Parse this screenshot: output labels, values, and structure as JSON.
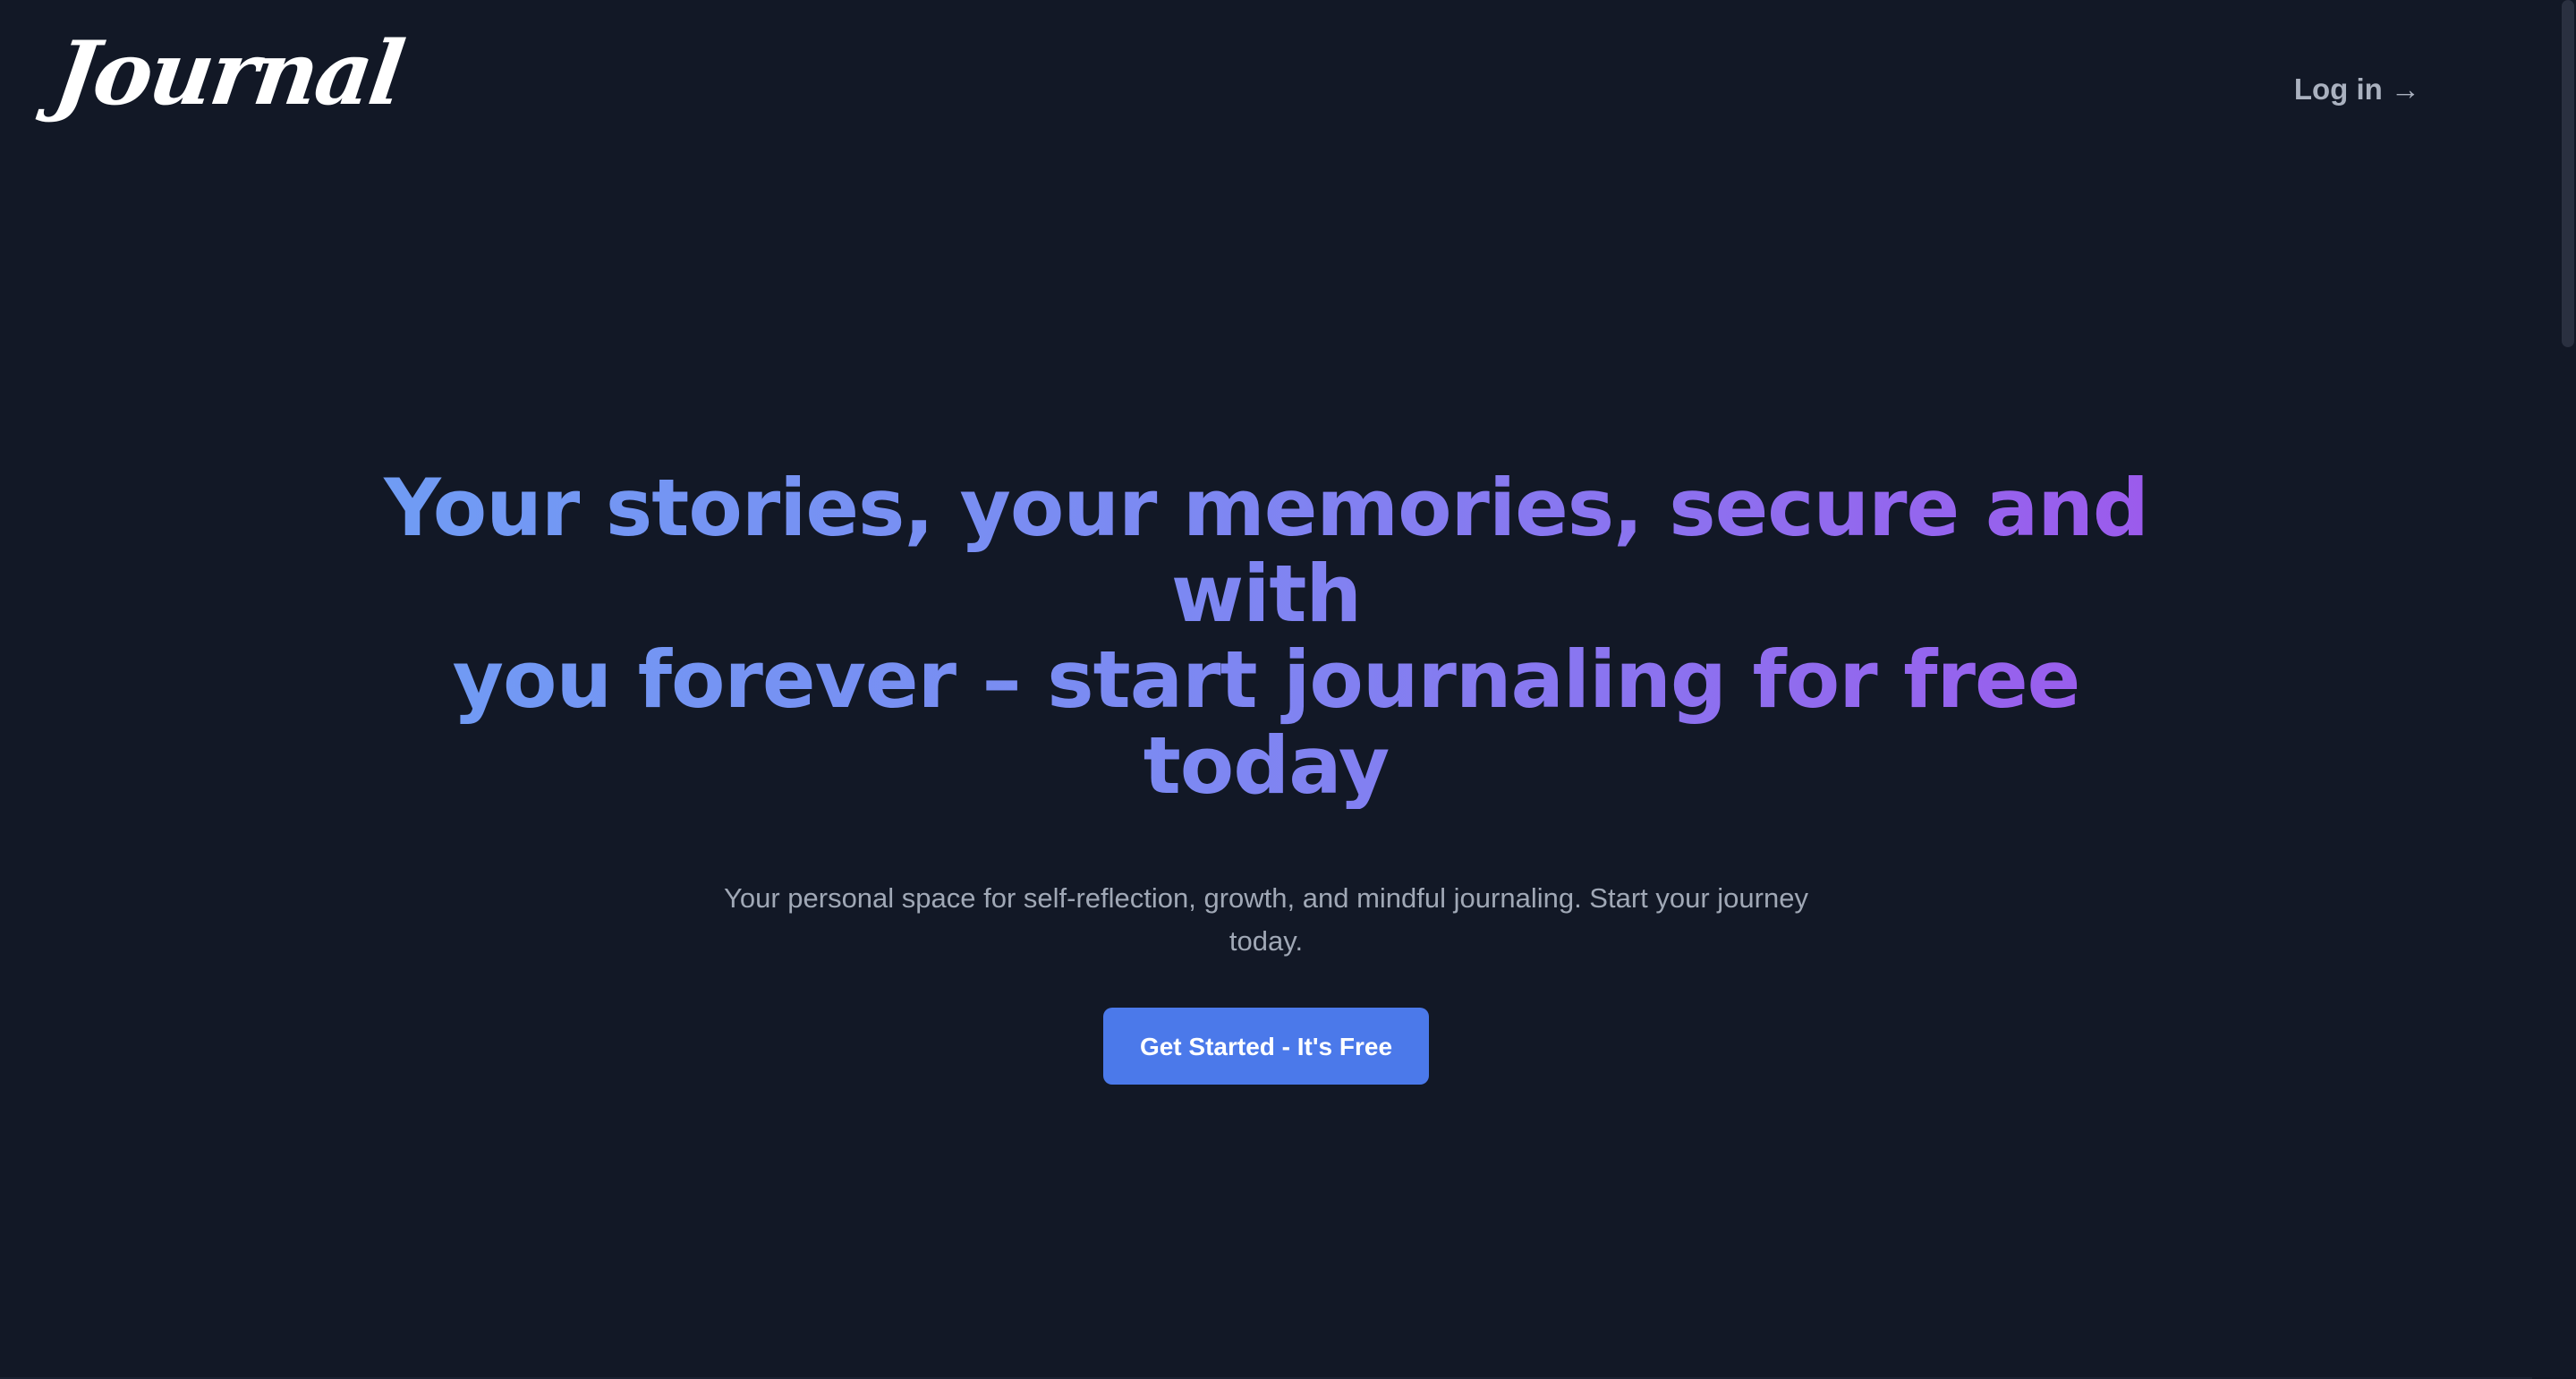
{
  "header": {
    "logo_text": "Journal",
    "login_label": "Log in →"
  },
  "hero": {
    "headline_line1": "Your stories, your memories, secure and with",
    "headline_line2": "you forever – start journaling for free today",
    "subline": "Your personal space for self-reflection, growth, and mindful journaling. Start your journey today.",
    "cta_label": "Get Started - It's Free"
  },
  "colors": {
    "background": "#121826",
    "accent": "#4b79ea",
    "gradient_start": "#6f9df4",
    "gradient_end": "#9d58ec",
    "muted_text": "#a0a8b6"
  }
}
